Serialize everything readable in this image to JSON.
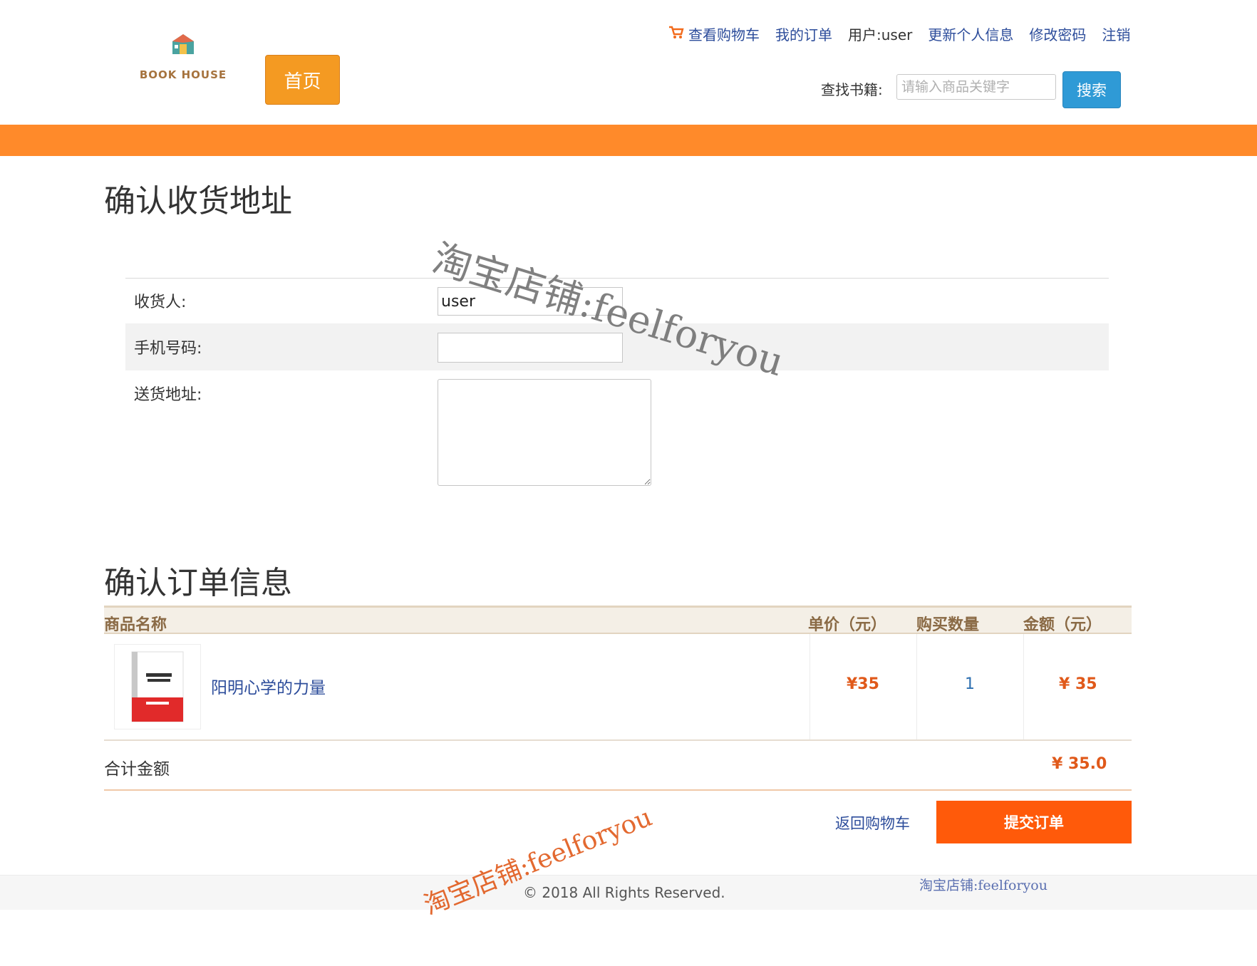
{
  "header": {
    "logo_text": "BOOK HOUSE",
    "home_label": "首页",
    "nav": {
      "cart": "查看购物车",
      "orders": "我的订单",
      "user": "用户:user",
      "profile": "更新个人信息",
      "password": "修改密码",
      "logout": "注销"
    },
    "search": {
      "label": "查找书籍:",
      "placeholder": "请输入商品关键字",
      "button": "搜索"
    }
  },
  "address": {
    "title": "确认收货地址",
    "receiver_label": "收货人:",
    "receiver_value": "user",
    "phone_label": "手机号码:",
    "phone_value": "",
    "address_label": "送货地址:",
    "address_value": ""
  },
  "order": {
    "title": "确认订单信息",
    "columns": {
      "name": "商品名称",
      "unit_price": "单价（元）",
      "quantity": "购买数量",
      "amount": "金额（元）"
    },
    "items": [
      {
        "name": "阳明心学的力量",
        "unit_price": "¥35",
        "quantity": "1",
        "amount": "¥ 35"
      }
    ],
    "total_label": "合计金额",
    "total_value": "¥ 35.0",
    "back_label": "返回购物车",
    "submit_label": "提交订单"
  },
  "footer": {
    "copyright": "© 2018 All Rights Reserved."
  },
  "watermarks": {
    "main": "淘宝店铺:feelforyou",
    "bottom": "淘宝店铺:feelforyou",
    "small": "淘宝店铺:feelforyou"
  },
  "colors": {
    "orange_bar": "#ff8a2a",
    "home_button": "#f49a22",
    "search_button": "#2f9ad6",
    "submit_button": "#ff5a0a",
    "price_text": "#e0591a",
    "link_text": "#2d4d9b"
  }
}
